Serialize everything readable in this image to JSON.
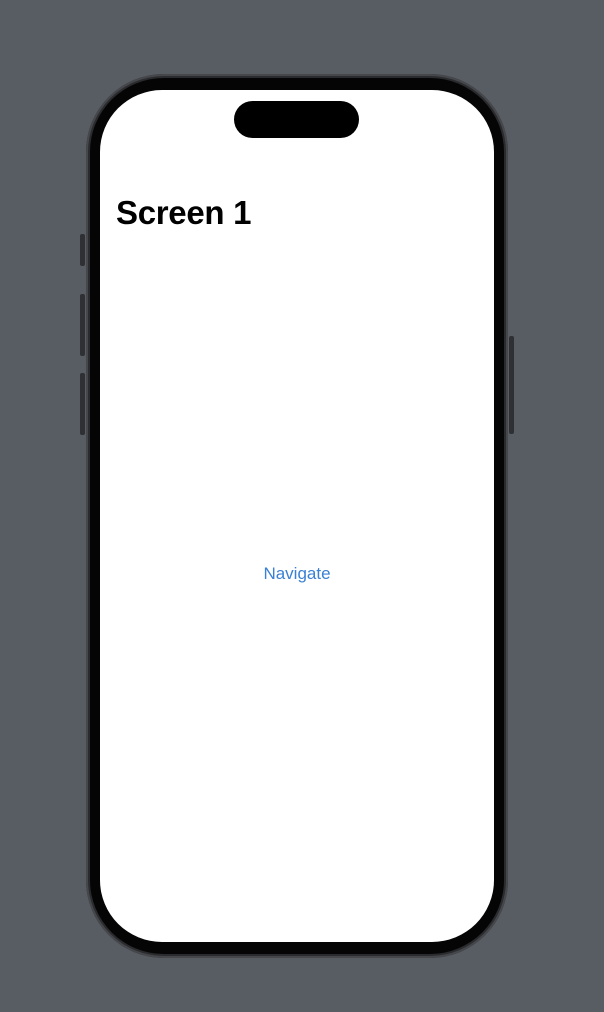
{
  "device": {
    "colors": {
      "background": "#585c63",
      "frame": "#2a2b2e",
      "bezel": "#050505",
      "screen": "#ffffff"
    }
  },
  "screen": {
    "navigation_title": "Screen 1",
    "navigate_button_label": "Navigate",
    "colors": {
      "title": "#000000",
      "button_tint": "#3a80d4"
    }
  }
}
